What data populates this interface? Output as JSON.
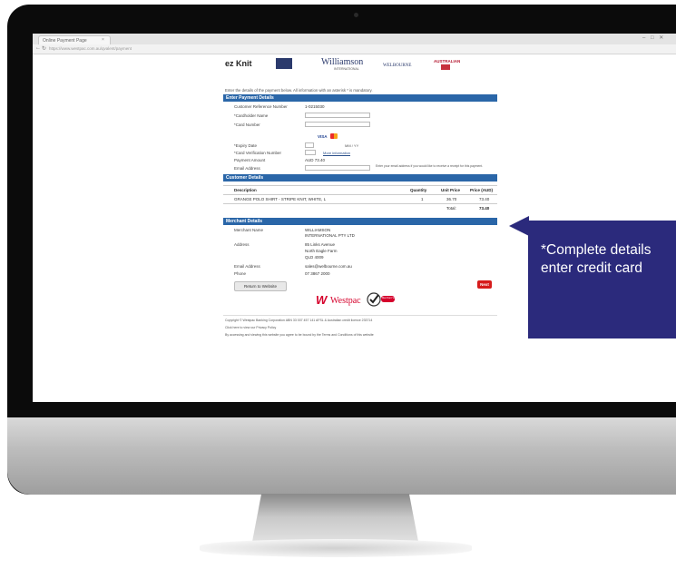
{
  "browser": {
    "tab_title": "Online Payment Page",
    "url": "https://www.westpac.com.au/qvalent/payment",
    "window_controls": "– □ ✕"
  },
  "logos": {
    "ezknit": "ez Knit",
    "williamson": "Williamson",
    "williamson_sub": "INTERNATIONAL",
    "welbourne": "WELBOURNE",
    "australian": "AUSTRALIAN"
  },
  "intro_text": "Enter the details of the payment below. All information with an asterisk * is mandatory.",
  "payment_section": {
    "header": "Enter Payment Details",
    "customer_ref_label": "Customer Reference Number",
    "customer_ref_value": "1-0215030",
    "cardholder_label": "*Cardholder Name",
    "card_number_label": "*Card Number",
    "card_brands": "VISA",
    "expiry_label": "*Expiry Date",
    "expiry_hint": "MM / YY",
    "cvn_label": "*Card Verification Number",
    "more_info": "More information",
    "amount_label": "Payment Amount",
    "amount_value": "AUD 73.40",
    "email_label": "Email Address",
    "email_hint": "Enter your email address if you would like to receive a receipt for this payment."
  },
  "customer_section": {
    "header": "Customer Details",
    "columns": [
      "Description",
      "Quantity",
      "Unit Price",
      "Price (AUD)"
    ],
    "row": {
      "description": "GRANGE POLO SHIRT - STRIPE KNIT, WHITE, L",
      "quantity": "1",
      "unit_price": "36.70",
      "price": "73.40"
    },
    "total_label": "Total:",
    "total_value": "73.40"
  },
  "merchant_section": {
    "header": "Merchant Details",
    "name_label": "Merchant Name",
    "name_value_1": "WILLIAMSON",
    "name_value_2": "INTERNATIONAL PTY LTD",
    "address_label": "Address",
    "address_1": "85 Links Avenue",
    "address_2": "North Eagle Farm",
    "address_3": "QLD 4009",
    "email_label": "Email Address",
    "email_value": "sales@welbourne.com.au",
    "phone_label": "Phone",
    "phone_value": "07 3867 2000"
  },
  "buttons": {
    "return": "Return to Website",
    "next": "Next"
  },
  "westpac": {
    "brand": "Westpac",
    "badge": "Merchant Verified"
  },
  "footer": {
    "line1": "Copyright © Westpac Banking Corporation ABN 33 007 457 141 AFSL & Australian credit licence 233714",
    "line2": "Click here to view our Privacy Policy",
    "line3": "By accessing and viewing this website you agree to be bound by the Terms and Conditions of this website"
  },
  "callout": {
    "line1": "*Complete details",
    "line2": "enter credit card"
  },
  "colors": {
    "section_blue": "#2a66a8",
    "callout_navy": "#2b2a7c",
    "westpac_red": "#d5002b",
    "next_red": "#d61c1c"
  }
}
